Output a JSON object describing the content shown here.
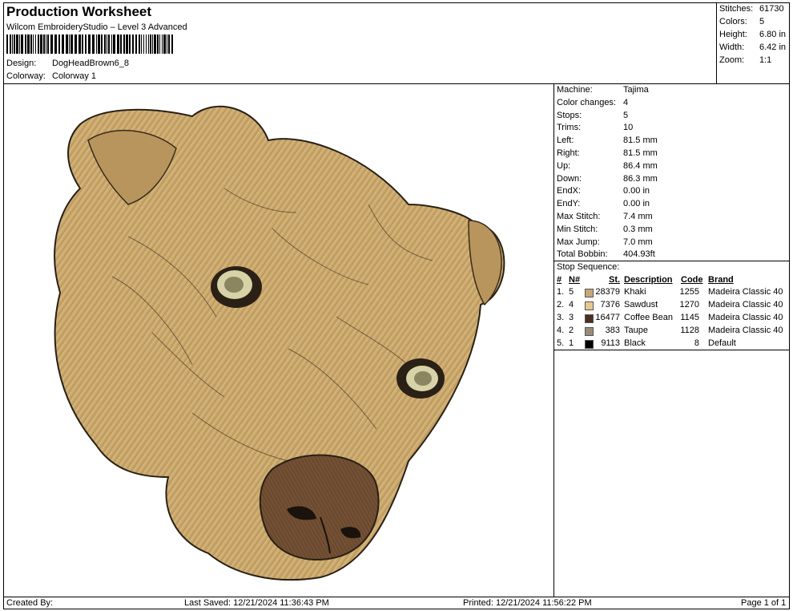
{
  "header": {
    "title": "Production Worksheet",
    "software": "Wilcom EmbroideryStudio – Level 3 Advanced",
    "design_label": "Design:",
    "design_value": "DogHeadBrown6_8",
    "colorway_label": "Colorway:",
    "colorway_value": "Colorway 1"
  },
  "summary": [
    {
      "label": "Stitches:",
      "value": "61730"
    },
    {
      "label": "Colors:",
      "value": "5"
    },
    {
      "label": "Height:",
      "value": "6.80 in"
    },
    {
      "label": "Width:",
      "value": "6.42 in"
    },
    {
      "label": "Zoom:",
      "value": "1:1"
    }
  ],
  "machine_info": [
    {
      "label": "Machine:",
      "value": "Tajima"
    },
    {
      "label": "Color changes:",
      "value": "4"
    },
    {
      "label": "Stops:",
      "value": "5"
    },
    {
      "label": "Trims:",
      "value": "10"
    },
    {
      "label": "Left:",
      "value": "81.5 mm"
    },
    {
      "label": "Right:",
      "value": "81.5 mm"
    },
    {
      "label": "Up:",
      "value": "86.4 mm"
    },
    {
      "label": "Down:",
      "value": "86.3 mm"
    },
    {
      "label": "EndX:",
      "value": "0.00 in"
    },
    {
      "label": "EndY:",
      "value": "0.00 in"
    },
    {
      "label": "Max Stitch:",
      "value": "7.4 mm"
    },
    {
      "label": "Min Stitch:",
      "value": "0.3 mm"
    },
    {
      "label": "Max Jump:",
      "value": "7.0 mm"
    },
    {
      "label": "Total Bobbin:",
      "value": "404.93ft"
    }
  ],
  "stop_sequence": {
    "title": "Stop Sequence:",
    "headers": {
      "num": "#",
      "n": "N#",
      "st": "St.",
      "description": "Description",
      "code": "Code",
      "brand": "Brand"
    },
    "rows": [
      {
        "num": "1.",
        "n": "5",
        "st": "28379",
        "description": "Khaki",
        "code": "1255",
        "brand": "Madeira Classic 40",
        "color": "#c8a878"
      },
      {
        "num": "2.",
        "n": "4",
        "st": "7376",
        "description": "Sawdust",
        "code": "1270",
        "brand": "Madeira Classic 40",
        "color": "#e8c890"
      },
      {
        "num": "3.",
        "n": "3",
        "st": "16477",
        "description": "Coffee Bean",
        "code": "1145",
        "brand": "Madeira Classic 40",
        "color": "#4a3020"
      },
      {
        "num": "4.",
        "n": "2",
        "st": "383",
        "description": "Taupe",
        "code": "1128",
        "brand": "Madeira Classic 40",
        "color": "#9a8a7a"
      },
      {
        "num": "5.",
        "n": "1",
        "st": "9113",
        "description": "Black",
        "code": "8",
        "brand": "Default",
        "color": "#000000"
      }
    ]
  },
  "footer": {
    "created_by": "Created By:",
    "last_saved": "Last Saved: 12/21/2024 11:36:43 PM",
    "printed": "Printed: 12/21/2024 11:56:22 PM",
    "page": "Page 1 of 1"
  },
  "design_image": {
    "icon": "embroidery-dog-head",
    "fur_color": "#c9a86a",
    "nose_color": "#6b4a30",
    "outline_color": "#2a2016"
  }
}
